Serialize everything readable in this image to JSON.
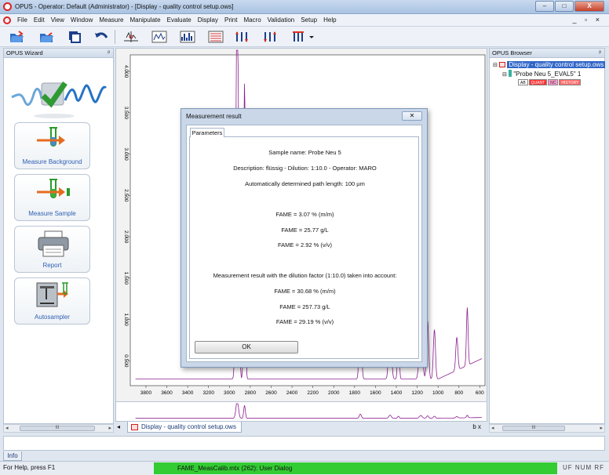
{
  "window": {
    "title": "OPUS - Operator: Default  (Administrator) - [Display - quality control setup.ows]",
    "minimize": "–",
    "maximize": "□",
    "close": "X"
  },
  "menu": [
    {
      "label": "File"
    },
    {
      "label": "Edit"
    },
    {
      "label": "View"
    },
    {
      "label": "Window"
    },
    {
      "label": "Measure"
    },
    {
      "label": "Manipulate"
    },
    {
      "label": "Evaluate"
    },
    {
      "label": "Display"
    },
    {
      "label": "Print"
    },
    {
      "label": "Macro"
    },
    {
      "label": "Validation"
    },
    {
      "label": "Setup"
    },
    {
      "label": "Help"
    }
  ],
  "mdi_controls": "_ ▫ ×",
  "wizard": {
    "title": "OPUS Wizard",
    "pin": "ᵖ",
    "buttons": [
      {
        "label": "Measure Background"
      },
      {
        "label": "Measure Sample"
      },
      {
        "label": "Report"
      },
      {
        "label": "Autosampler"
      }
    ]
  },
  "browser": {
    "title": "OPUS Browser",
    "pin": "ᵖ",
    "root": "Display - quality control setup.ows",
    "file": "\"Probe Neu 5_EVAL5\" 1",
    "blocks": [
      "AB",
      "QUANT",
      "NC",
      "HISTORY"
    ]
  },
  "chart_data": {
    "type": "line",
    "x_ticks": [
      "3800",
      "3600",
      "3400",
      "3200",
      "3000",
      "2800",
      "2600",
      "2400",
      "2200",
      "2000",
      "1800",
      "1600",
      "1400",
      "1200",
      "1000",
      "800",
      "600"
    ],
    "y_ticks": [
      "0.500",
      "1.000",
      "1.500",
      "2.000",
      "2.500",
      "3.000",
      "3.500",
      "4.000"
    ],
    "xlim": [
      3950,
      550
    ],
    "ylim": [
      0.2,
      4.2
    ]
  },
  "doc_tab": "Display - quality control setup.ows",
  "scroll": {
    "left": "◂",
    "right": "▸",
    "thumb": "III"
  },
  "tab_nav": {
    "left": "◂",
    "right": "b  x"
  },
  "info_tab": "Info",
  "status": {
    "help": "For Help, press F1",
    "task": "FAME_MeasCalib.mtx (262): User Dialog",
    "indicators": "UF  NUM  RF"
  },
  "dialog": {
    "title": "Measurement result",
    "close": "✕",
    "tab": "Parameters",
    "lines": [
      "Sample name: Probe Neu 5",
      "Description: flüssig - Dilution: 1:10.0 - Operator: MARO",
      "Automatically determined path length: 100 µm",
      "FAME = 3.07 % (m/m)",
      "FAME = 25.77 g/L",
      "FAME = 2.92 % (v/v)",
      "Measurement result with the dilution factor (1:10.0) taken into account:",
      "FAME = 30.68 % (m/m)",
      "FAME = 257.73 g/L",
      "FAME = 29.19 % (v/v)"
    ],
    "ok": "OK"
  }
}
